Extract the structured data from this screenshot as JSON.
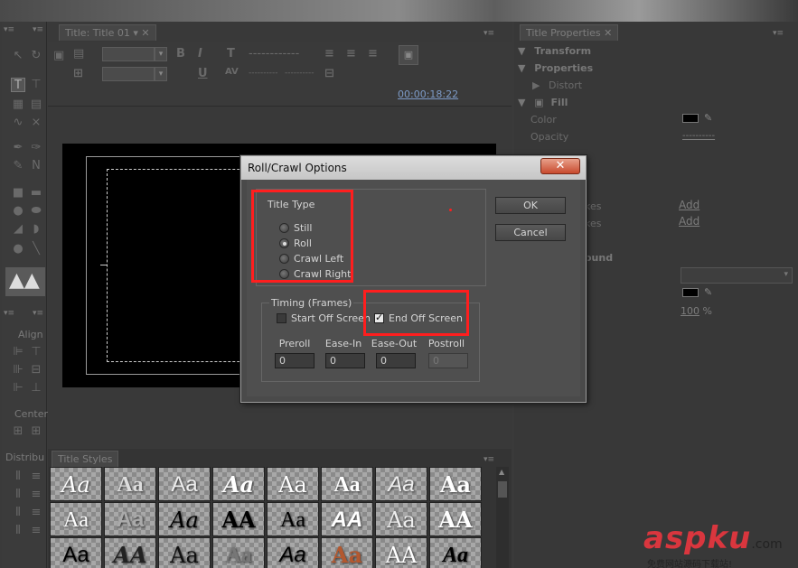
{
  "app": {
    "title_tab": "Title: Title 01",
    "title_styles_tab": "Title Styles",
    "title_properties_tab": "Title Properties",
    "timecode": "00:00:18:22"
  },
  "left_panel": {
    "align_label": "Align",
    "center_label": "Center",
    "distribute_label": "Distribu"
  },
  "properties": {
    "transform": "Transform",
    "properties": "Properties",
    "distort": "Distort",
    "fill": "Fill",
    "color": "Color",
    "opacity": "Opacity",
    "opacity_value": "----------",
    "inner_strokes_frag": "kes",
    "outer_strokes_frag": "kes",
    "add1": "Add",
    "add2": "Add",
    "background_frag": "ound",
    "percent_value": "100",
    "percent_unit": "%",
    "fill_color": "#000000",
    "shadow_color": "#000000"
  },
  "styles": {
    "row1": [
      "Aa",
      "Aa",
      "Aa",
      "Aa",
      "Aa",
      "Aa",
      "Aa",
      "Aa"
    ],
    "row2": [
      "Aa",
      "Aa",
      "Aa",
      "AA",
      "Aa",
      "AA",
      "Aa",
      "AA"
    ],
    "row3": [
      "Aa",
      "AA",
      "Aa",
      "Aa",
      "Aa",
      "Aa",
      "AA",
      "Aa"
    ]
  },
  "dialog": {
    "title": "Roll/Crawl Options",
    "close_glyph": "✕",
    "title_type_label": "Title Type",
    "title_type_options": [
      "Still",
      "Roll",
      "Crawl Left",
      "Crawl Right"
    ],
    "selected_option": "Roll",
    "timing_label": "Timing (Frames)",
    "start_off_screen": "Start Off Screen",
    "start_off_screen_checked": false,
    "end_off_screen": "End Off Screen",
    "end_off_screen_checked": true,
    "preroll_label": "Preroll",
    "preroll_value": "0",
    "ease_in_label": "Ease-In",
    "ease_in_value": "0",
    "ease_out_label": "Ease-Out",
    "ease_out_value": "0",
    "postroll_label": "Postroll",
    "postroll_value": "0",
    "ok_label": "OK",
    "cancel_label": "Cancel",
    "highlight_color": "#ff1e1e"
  },
  "watermark": {
    "brand": "aspku",
    "tld": ".com",
    "subtitle": "免费网站源码下载站!"
  }
}
